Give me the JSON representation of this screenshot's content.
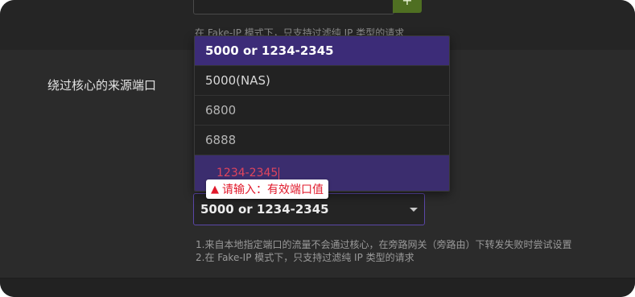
{
  "top_section": {
    "add_button_icon": "plus-icon",
    "hint": "在 Fake-IP 模式下，只支持过滤纯 IP 类型的请求"
  },
  "field": {
    "label": "绕过核心的来源端口"
  },
  "dropdown": {
    "options": [
      {
        "label": "5000 or 1234-2345"
      },
      {
        "label": "5000(NAS)"
      },
      {
        "label": "6800"
      },
      {
        "label": "6888"
      }
    ],
    "typed_value": "1234-2345"
  },
  "validation": {
    "icon": "warning-icon",
    "icon_glyph": "▲",
    "message": "请输入：有效端口值"
  },
  "select": {
    "value": "5000 or 1234-2345"
  },
  "help": {
    "line1": "1.来自本地指定端口的流量不会通过核心，在旁路网关（旁路由）下转发失败时尝试设置",
    "line2": "2.在 Fake-IP 模式下，只支持过滤纯 IP 类型的请求"
  },
  "colors": {
    "selected_option_bg": "#3c2c78",
    "error_text": "#e0192b",
    "focus_border": "#5b47a8",
    "add_button_bg": "#4f6f22"
  }
}
